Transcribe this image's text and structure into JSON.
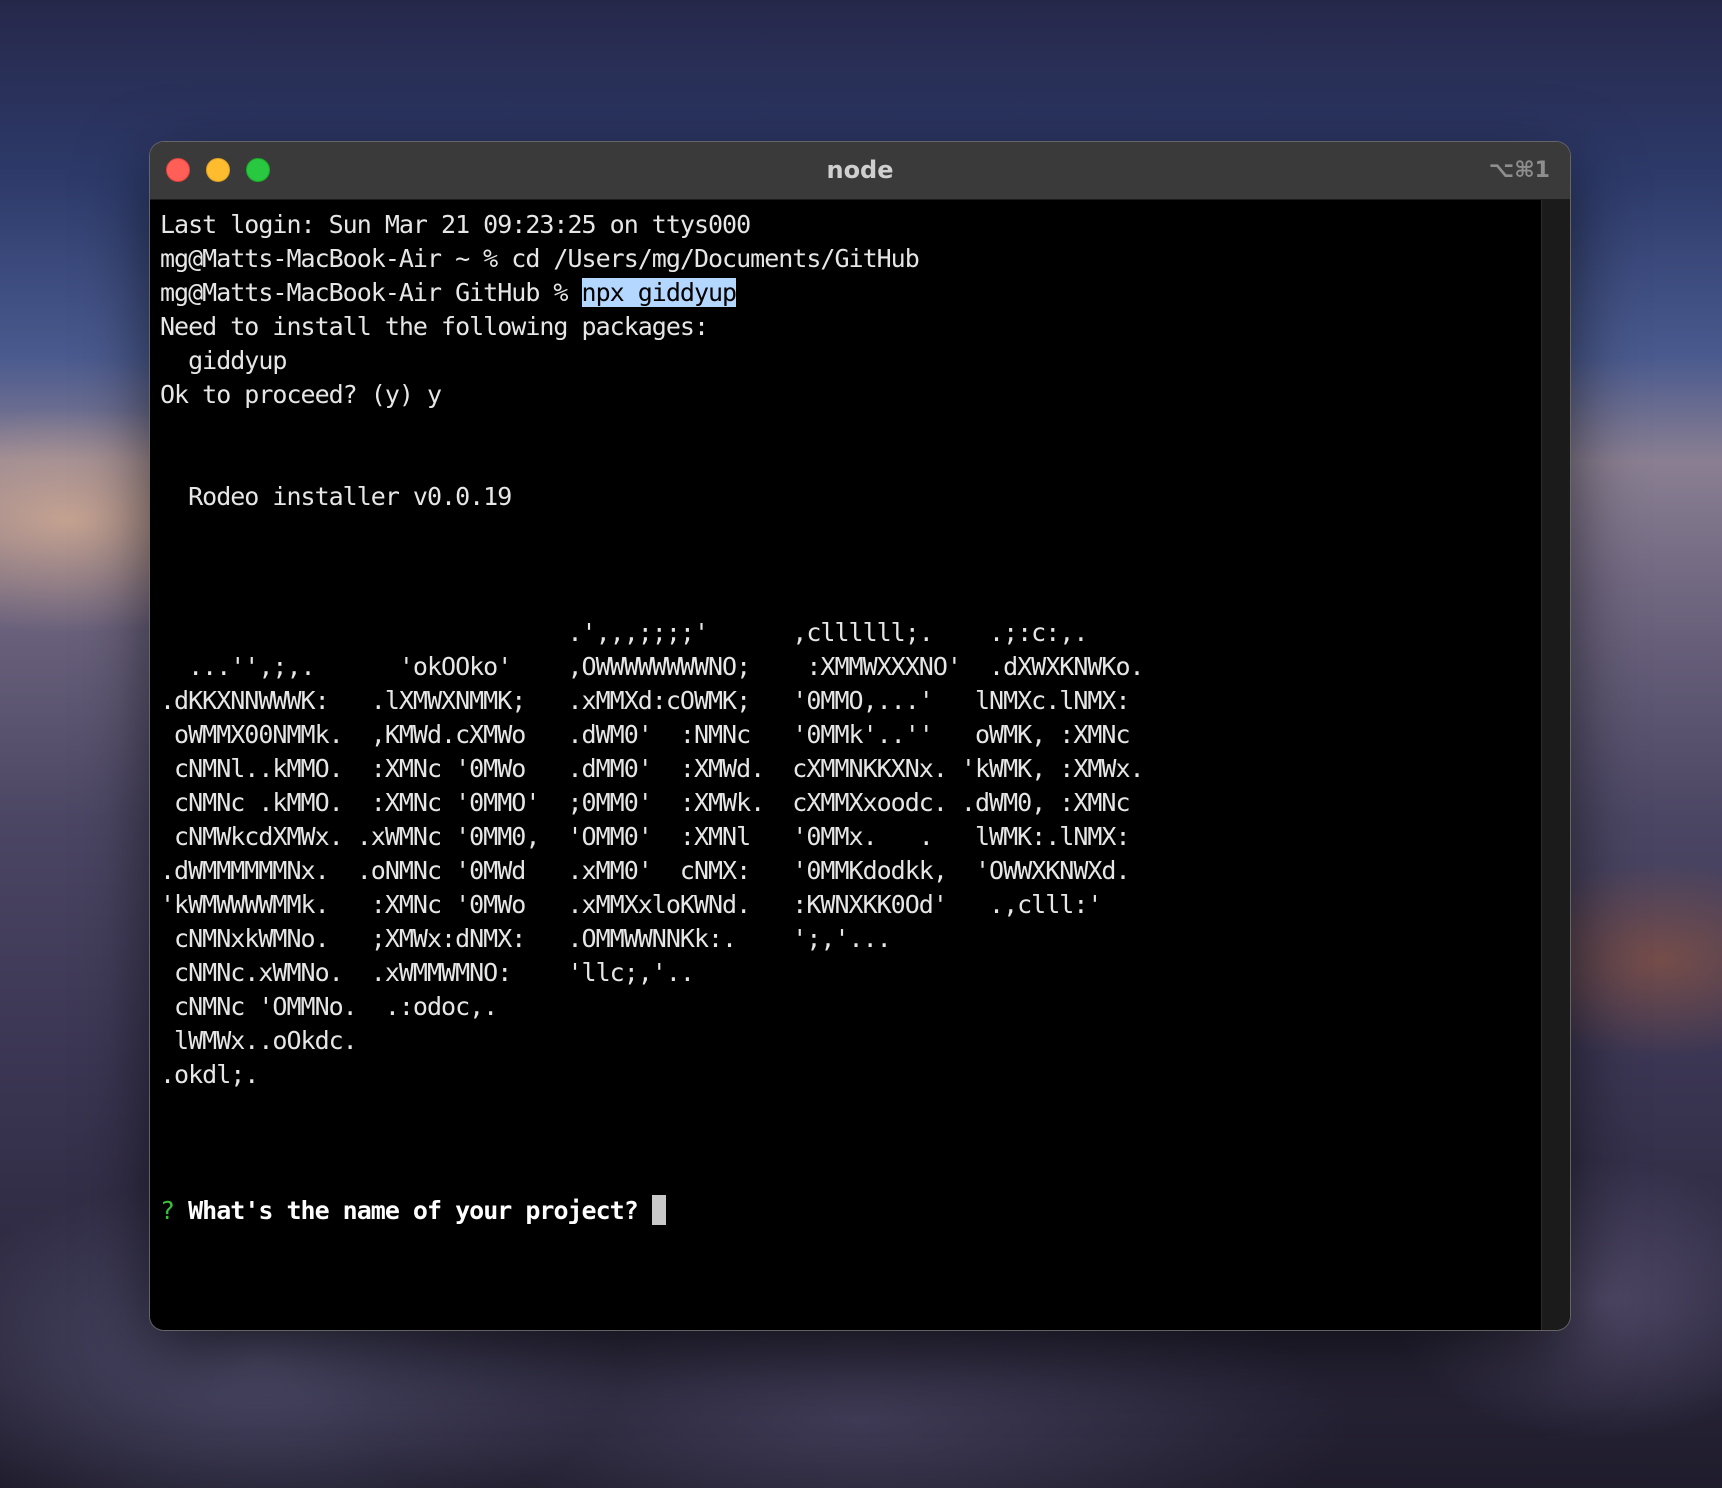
{
  "window": {
    "title": "node",
    "shortcut": "⌥⌘1"
  },
  "terminal": {
    "last_login": "Last login: Sun Mar 21 09:23:25 on ttys000",
    "cmd1": "mg@Matts-MacBook-Air ~ % cd /Users/mg/Documents/GitHub",
    "cmd2_prompt": "mg@Matts-MacBook-Air GitHub % ",
    "cmd2_command": "npx giddyup",
    "install_msg": "Need to install the following packages:",
    "install_pkg": "  giddyup",
    "proceed": "Ok to proceed? (y) y",
    "installer_title": "  Rodeo installer v0.0.19",
    "ascii_art": [
      "                             .',,,;;;;'      ,cllllll;.    .;:c:,.",
      "  ...'',;,.      'okOOko'    ,OWWWWWWWWNO;    :XMMWXXXNO'  .dXWXKNWKo.",
      ".dKKXNNWWWK:   .lXMWXNMMK;   .xMMXd:cOWMK;   '0MMO,...'   lNMXc.lNMX:",
      " oWMMX00NMMk.  ,KMWd.cXMWo   .dWM0'  :NMNc   '0MMk'..''   oWMK, :XMNc",
      " cNMNl..kMMO.  :XMNc '0MWo   .dMM0'  :XMWd.  cXMMNKKXNx. 'kWMK, :XMWx.",
      " cNMNc .kMMO.  :XMNc '0MMO'  ;0MM0'  :XMWk.  cXMMXxoodc. .dWM0, :XMNc",
      " cNMWkcdXMWx. .xWMNc '0MM0,  'OMM0'  :XMNl   '0MMx.   .   lWMK:.lNMX:",
      ".dWMMMMMMNx.  .oNMNc '0MWd   .xMM0'  cNMX:   '0MMKdodkk,  'OWWXKNWXd.",
      "'kWMWWWWMMk.   :XMNc '0MWo   .xMMXxloKWNd.   :KWNXKK0Od'   .,clll:'",
      " cNMNxkWMNo.   ;XMWx:dNMX:   .OMMWWNNKk:.    ';,'...",
      " cNMNc.xWMNo.  .xWMMWMNO:    'llc;,'..",
      " cNMNc 'OMMNo.  .:odoc,.",
      " lWMWx..oOkdc.",
      ".okdl;."
    ],
    "question_mark": "?",
    "question_text": " What's the name of your project? "
  }
}
